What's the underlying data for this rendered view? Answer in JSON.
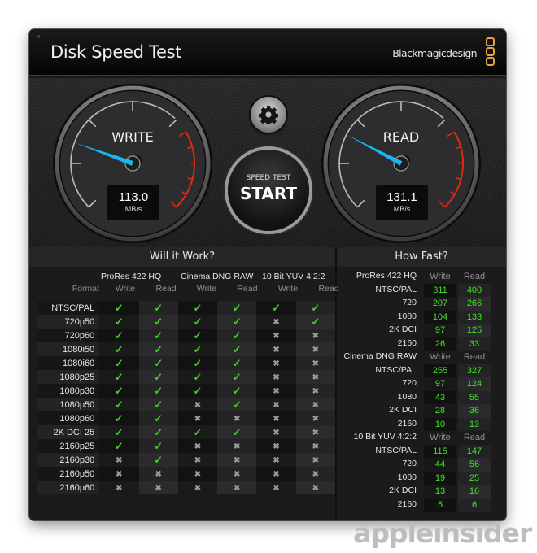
{
  "window": {
    "title": "Disk Speed Test",
    "brand": "Blackmagicdesign",
    "close_label": "×"
  },
  "gauges": {
    "write": {
      "label": "WRITE",
      "value": "113.0",
      "unit": "MB/s",
      "needle_fraction": 0.24
    },
    "read": {
      "label": "READ",
      "value": "131.1",
      "unit": "MB/s",
      "needle_fraction": 0.27
    }
  },
  "controls": {
    "settings_icon": "gear-icon",
    "start_sub": "SPEED TEST",
    "start_main": "START"
  },
  "will_it_work": {
    "title": "Will it Work?",
    "format_header": "Format",
    "groups": [
      "ProRes 422 HQ",
      "Cinema DNG RAW",
      "10 Bit YUV 4:2:2"
    ],
    "col_labels": [
      "Write",
      "Read",
      "Write",
      "Read",
      "Write",
      "Read"
    ],
    "rows": [
      {
        "format": "NTSC/PAL",
        "cells": [
          1,
          1,
          1,
          1,
          1,
          1
        ]
      },
      {
        "format": "720p50",
        "cells": [
          1,
          1,
          1,
          1,
          0,
          1
        ]
      },
      {
        "format": "720p60",
        "cells": [
          1,
          1,
          1,
          1,
          0,
          0
        ]
      },
      {
        "format": "1080i50",
        "cells": [
          1,
          1,
          1,
          1,
          0,
          0
        ]
      },
      {
        "format": "1080i60",
        "cells": [
          1,
          1,
          1,
          1,
          0,
          0
        ]
      },
      {
        "format": "1080p25",
        "cells": [
          1,
          1,
          1,
          1,
          0,
          0
        ]
      },
      {
        "format": "1080p30",
        "cells": [
          1,
          1,
          1,
          1,
          0,
          0
        ]
      },
      {
        "format": "1080p50",
        "cells": [
          1,
          1,
          0,
          1,
          0,
          0
        ]
      },
      {
        "format": "1080p60",
        "cells": [
          1,
          1,
          0,
          0,
          0,
          0
        ]
      },
      {
        "format": "2K DCI 25",
        "cells": [
          1,
          1,
          1,
          1,
          0,
          0
        ]
      },
      {
        "format": "2160p25",
        "cells": [
          1,
          1,
          0,
          0,
          0,
          0
        ]
      },
      {
        "format": "2160p30",
        "cells": [
          0,
          1,
          0,
          0,
          0,
          0
        ]
      },
      {
        "format": "2160p50",
        "cells": [
          0,
          0,
          0,
          0,
          0,
          0
        ]
      },
      {
        "format": "2160p60",
        "cells": [
          0,
          0,
          0,
          0,
          0,
          0
        ]
      }
    ],
    "yes_glyph": "✓",
    "no_glyph": "✖"
  },
  "how_fast": {
    "title": "How Fast?",
    "write_label": "Write",
    "read_label": "Read",
    "groups": [
      {
        "name": "ProRes 422 HQ",
        "rows": [
          {
            "format": "NTSC/PAL",
            "write": "311",
            "read": "400"
          },
          {
            "format": "720",
            "write": "207",
            "read": "266"
          },
          {
            "format": "1080",
            "write": "104",
            "read": "133"
          },
          {
            "format": "2K DCI",
            "write": "97",
            "read": "125"
          },
          {
            "format": "2160",
            "write": "26",
            "read": "33"
          }
        ]
      },
      {
        "name": "Cinema DNG RAW",
        "rows": [
          {
            "format": "NTSC/PAL",
            "write": "255",
            "read": "327"
          },
          {
            "format": "720",
            "write": "97",
            "read": "124"
          },
          {
            "format": "1080",
            "write": "43",
            "read": "55"
          },
          {
            "format": "2K DCI",
            "write": "28",
            "read": "36"
          },
          {
            "format": "2160",
            "write": "10",
            "read": "13"
          }
        ]
      },
      {
        "name": "10 Bit YUV 4:2:2",
        "rows": [
          {
            "format": "NTSC/PAL",
            "write": "115",
            "read": "147"
          },
          {
            "format": "720",
            "write": "44",
            "read": "56"
          },
          {
            "format": "1080",
            "write": "19",
            "read": "25"
          },
          {
            "format": "2K DCI",
            "write": "13",
            "read": "16"
          },
          {
            "format": "2160",
            "write": "5",
            "read": "6"
          }
        ]
      }
    ]
  },
  "watermark": "appleinsider",
  "colors": {
    "needle": "#19b8ec",
    "redline": "#e02a10",
    "ok": "#3fcf25",
    "value": "#41e621",
    "brand_accent": "#e8a33a"
  }
}
